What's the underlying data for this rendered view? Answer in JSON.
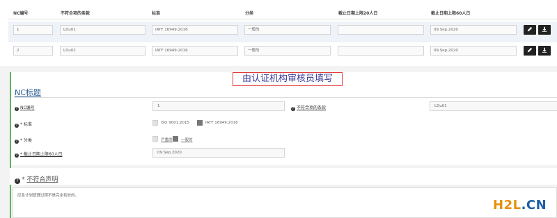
{
  "table": {
    "headers": {
      "nc_no": "NC编号",
      "nonconf_clause": "不符合项的条款",
      "standard": "标准",
      "category": "分类",
      "deadline20": "截止日期上限20人日",
      "deadline60": "截止日期上限60人日"
    },
    "rows": [
      {
        "nc_no": "1",
        "clause": "LDu01",
        "standard": "IATF 16949:2016",
        "category": "一般的",
        "deadline20": "",
        "deadline60": "09.Sep.2020"
      },
      {
        "nc_no": "2",
        "clause": "LDu02",
        "standard": "IATF 16949:2016",
        "category": "一般的",
        "deadline20": "",
        "deadline60": "09.Sep.2020"
      }
    ]
  },
  "annotation": "由认证机构审核员填写",
  "form": {
    "section_title": "NC标题",
    "nc_no_label": "NC编号",
    "nc_no_value": "1",
    "clause_label": "不符合项的条款",
    "clause_value": "LDu01",
    "standard_label": "* 标准",
    "standard_options": [
      "ISO 9001:2015",
      "IATF 16949:2016"
    ],
    "category_label": "* 分类",
    "category_options": [
      "严重的",
      "一般的"
    ],
    "deadline_label": "* 截止日期上限60人日",
    "deadline_value": "09.Sep.2020"
  },
  "statement": {
    "prefix": "* ",
    "title": "不符合声明",
    "text": "应急计划管理过程不是完全有效的。"
  },
  "watermark": {
    "part1": "H2L",
    "part2": ".CN"
  },
  "icons": {
    "edit": "pencil-icon",
    "download": "download-icon",
    "help": "question-circle-icon"
  }
}
